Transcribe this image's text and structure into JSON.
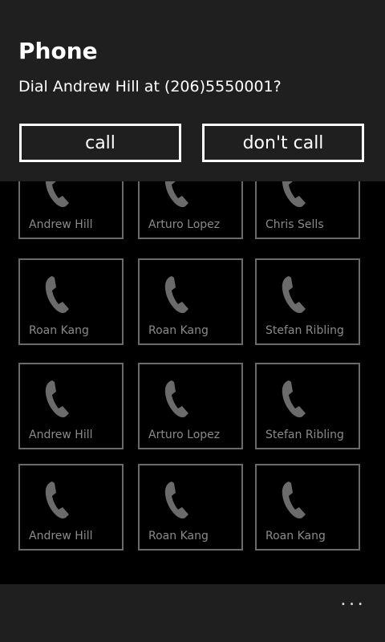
{
  "dialog": {
    "title": "Phone",
    "message": "Dial Andrew Hill at (206)5550001?",
    "call_label": "call",
    "dont_call_label": "don't call"
  },
  "contacts": [
    {
      "name": "Andrew Hill",
      "icon": "phone-icon"
    },
    {
      "name": "Arturo Lopez",
      "icon": "phone-icon"
    },
    {
      "name": "Chris Sells",
      "icon": "phone-icon"
    },
    {
      "name": "Roan Kang",
      "icon": "phone-icon"
    },
    {
      "name": "Roan Kang",
      "icon": "phone-icon"
    },
    {
      "name": "Stefan Ribling",
      "icon": "phone-icon"
    },
    {
      "name": "Andrew Hill",
      "icon": "phone-icon"
    },
    {
      "name": "Arturo Lopez",
      "icon": "phone-icon"
    },
    {
      "name": "Stefan Ribling",
      "icon": "phone-icon"
    },
    {
      "name": "Andrew Hill",
      "icon": "phone-icon"
    },
    {
      "name": "Roan Kang",
      "icon": "phone-icon"
    },
    {
      "name": "Roan Kang",
      "icon": "phone-icon"
    }
  ],
  "appbar": {
    "more_label": "..."
  },
  "colors": {
    "background": "#000000",
    "dialog_background": "#1f1f1f",
    "tile_border": "#6a6a6a",
    "tile_text": "#8a8a8a",
    "icon": "#6b6b6b"
  }
}
